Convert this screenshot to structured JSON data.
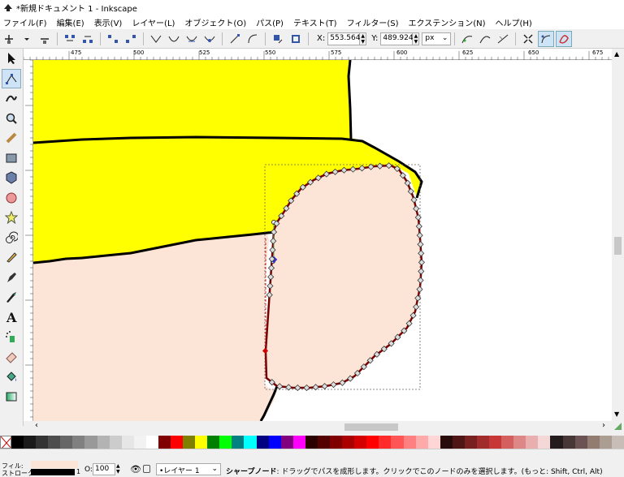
{
  "window": {
    "title": "*新規ドキュメント 1 - Inkscape"
  },
  "menu": [
    "ファイル(F)",
    "編集(E)",
    "表示(V)",
    "レイヤー(L)",
    "オブジェクト(O)",
    "パス(P)",
    "テキスト(T)",
    "フィルター(S)",
    "エクステンション(N)",
    "ヘルプ(H)"
  ],
  "toolbar": {
    "x_label": "X:",
    "x_value": "553.564",
    "y_label": "Y:",
    "y_value": "489.924",
    "unit": "px"
  },
  "ruler": {
    "top_ticks": [
      "475",
      "500",
      "525",
      "550",
      "575",
      "600",
      "625",
      "650",
      "675"
    ]
  },
  "statusbar": {
    "fill_label": "フィル:",
    "stroke_label": "ストローク:",
    "stroke_width": "1",
    "opacity_label": "O:",
    "opacity_value": "100",
    "layer": "•レイヤー 1",
    "message_bold": "シャープノード",
    "message": ": ドラッグでパスを成形します。クリックでこのノードのみを選択します。(もっと: Shift, Ctrl, Alt)"
  },
  "colors": {
    "yellow_fill": "#ffff00",
    "peach_fill": "#fce4d6",
    "selected_stroke": "#7a0000",
    "palette": [
      "#000000",
      "#1a1a1a",
      "#333333",
      "#4d4d4d",
      "#666666",
      "#808080",
      "#999999",
      "#b3b3b3",
      "#cccccc",
      "#e6e6e6",
      "#f2f2f2",
      "#ffffff",
      "#800000",
      "#ff0000",
      "#808000",
      "#ffff00",
      "#008000",
      "#00ff00",
      "#008080",
      "#00ffff",
      "#000080",
      "#0000ff",
      "#800080",
      "#ff00ff",
      "#2b0000",
      "#550000",
      "#800000",
      "#aa0000",
      "#d40000",
      "#ff0000",
      "#ff2a2a",
      "#ff5555",
      "#ff8080",
      "#ffaaaa",
      "#ffd5d5",
      "#280b0b",
      "#501616",
      "#782121",
      "#a02c2c",
      "#c83737",
      "#d35f5f",
      "#de8787",
      "#e9afaf",
      "#f4d7d7",
      "#241c1c",
      "#483737",
      "#6c5353",
      "#917c6f",
      "#ac9d93",
      "#c8beb7"
    ]
  }
}
